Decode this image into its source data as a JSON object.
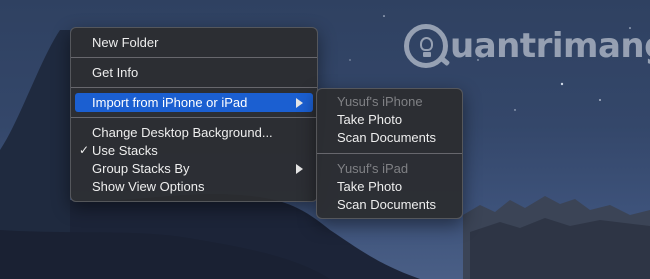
{
  "watermark": {
    "text": "uantrimang"
  },
  "context_menu": {
    "items": [
      {
        "label": "New Folder"
      },
      {
        "label": "Get Info"
      },
      {
        "label": "Import from iPhone or iPad",
        "highlighted": true,
        "submenu": true
      },
      {
        "label": "Change Desktop Background..."
      },
      {
        "label": "Use Stacks",
        "checked": true,
        "checkmark": "✓"
      },
      {
        "label": "Group Stacks By",
        "submenu": true
      },
      {
        "label": "Show View Options"
      }
    ]
  },
  "submenu": {
    "groups": [
      {
        "device": "Yusuf's iPhone",
        "actions": [
          "Take Photo",
          "Scan Documents"
        ]
      },
      {
        "device": "Yusuf's iPad",
        "actions": [
          "Take Photo",
          "Scan Documents"
        ]
      }
    ]
  },
  "colors": {
    "highlight": "#1b5fd1",
    "menu_bg": "#2c2d30",
    "disabled_text": "#7f8084"
  }
}
